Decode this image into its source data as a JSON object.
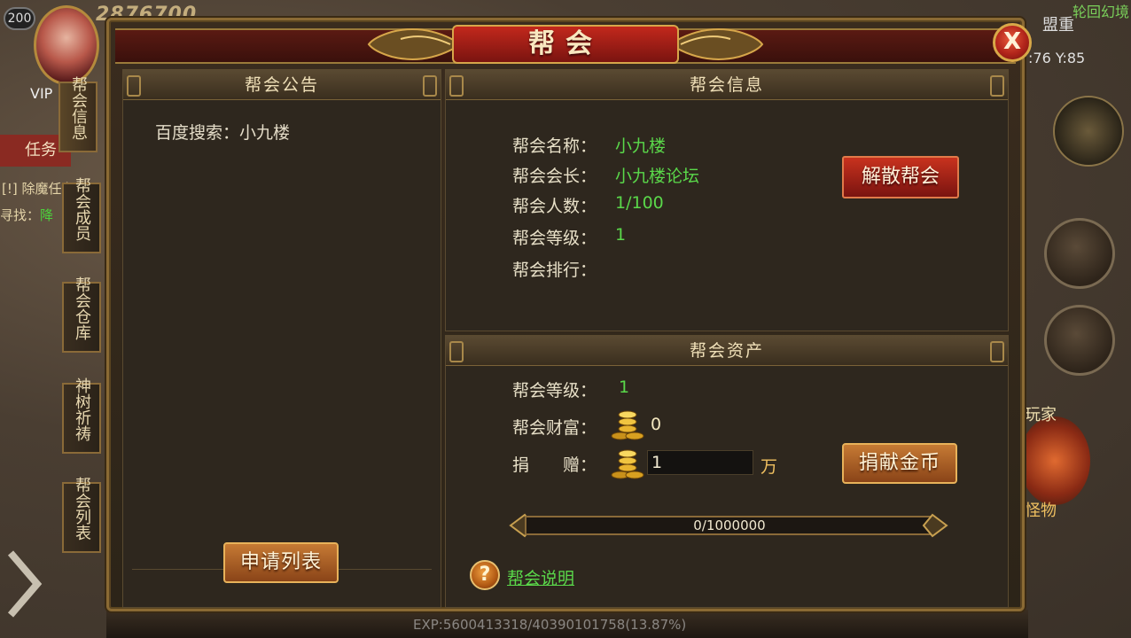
{
  "hud": {
    "level": "200",
    "power": "2876700",
    "vip": "VIP",
    "task": "任务",
    "quest": "[!] 除魔任务",
    "find_label": "寻找：",
    "find_target": "降",
    "top_right_1": "盟重",
    "top_right_2": "轮回幻境",
    "coords": ":76 Y:85",
    "player_label": "玩家",
    "monster_label": "怪物",
    "exp": "EXP:5600413318/40390101758(13.87%)"
  },
  "side_tabs": [
    {
      "label": "帮会信息",
      "active": true
    },
    {
      "label": "帮会成员",
      "active": false
    },
    {
      "label": "帮会仓库",
      "active": false
    },
    {
      "label": "神树祈祷",
      "active": false
    },
    {
      "label": "帮会列表",
      "active": false
    }
  ],
  "dialog": {
    "title": "帮会",
    "close_glyph": "X"
  },
  "notice": {
    "header": "帮会公告",
    "text": "百度搜索：小九楼",
    "apply_list_button": "申请列表"
  },
  "info": {
    "header": "帮会信息",
    "name_label": "帮会名称：",
    "name_value": "小九楼",
    "leader_label": "帮会会长：",
    "leader_value": "小九楼论坛",
    "members_label": "帮会人数：",
    "members_value": "1/100",
    "level_label": "帮会等级：",
    "level_value": "1",
    "rank_label": "帮会排行：",
    "rank_value": "",
    "disband_button": "解散帮会"
  },
  "assets": {
    "header": "帮会资产",
    "level_label": "帮会等级：",
    "level_value": "1",
    "wealth_label": "帮会财富：",
    "wealth_value": "0",
    "donate_label": "捐　　赠：",
    "donate_value": "1",
    "donate_unit": "万",
    "donate_button": "捐献金币",
    "progress_text": "0/1000000",
    "progress_fraction": 0,
    "help_link": "帮会说明"
  },
  "colors": {
    "accent_green": "#5ad84a",
    "title_red": "#c2281c",
    "button_orange": "#c67a34"
  }
}
